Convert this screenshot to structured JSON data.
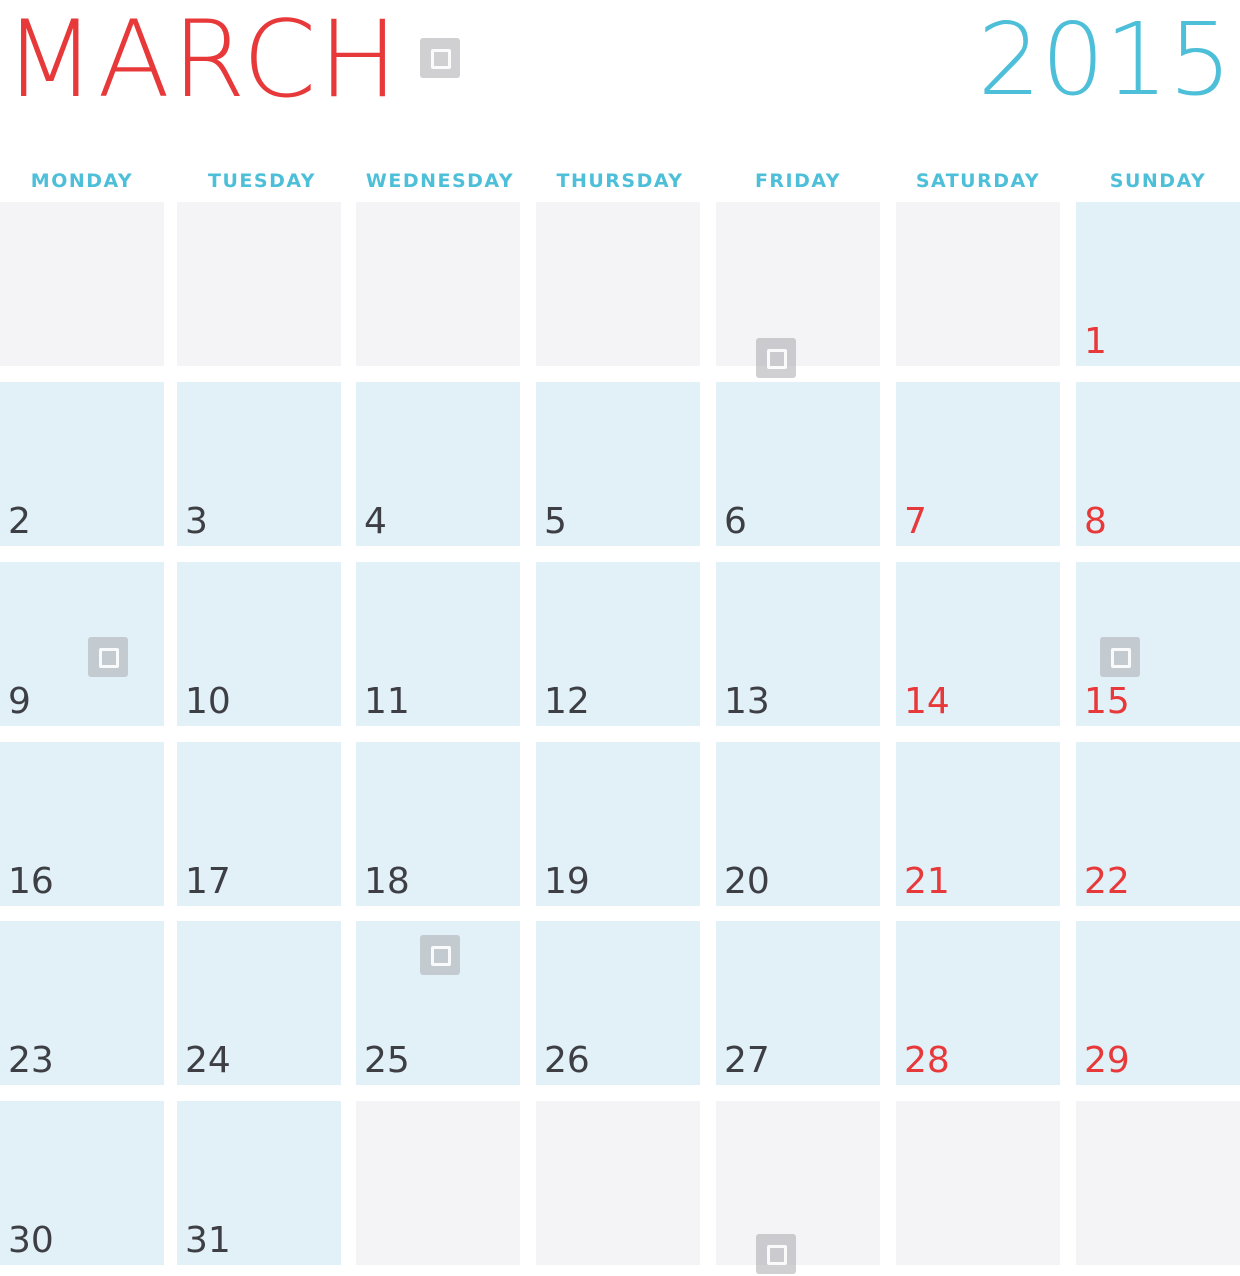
{
  "header": {
    "month": "MARCH",
    "year": "2015"
  },
  "weekdays": [
    "MONDAY",
    "TUESDAY",
    "WEDNESDAY",
    "THURSDAY",
    "FRIDAY",
    "SATURDAY",
    "SUNDAY"
  ],
  "weeks": [
    [
      "",
      "",
      "",
      "",
      "",
      "",
      "1"
    ],
    [
      "2",
      "3",
      "4",
      "5",
      "6",
      "7",
      "8"
    ],
    [
      "9",
      "10",
      "11",
      "12",
      "13",
      "14",
      "15"
    ],
    [
      "16",
      "17",
      "18",
      "19",
      "20",
      "21",
      "22"
    ],
    [
      "23",
      "24",
      "25",
      "26",
      "27",
      "28",
      "29"
    ],
    [
      "30",
      "31",
      "",
      "",
      "",
      "",
      ""
    ]
  ],
  "colors": {
    "month_title": "#e8393a",
    "year_title": "#4ebfd8",
    "weekday_label": "#4ebfd8",
    "day_cell": "#e2f1f8",
    "empty_cell": "#f4f3f5",
    "weekday_number": "#3d3f45",
    "weekend_number": "#e8393a"
  },
  "icons": [
    "watermark-icon"
  ]
}
